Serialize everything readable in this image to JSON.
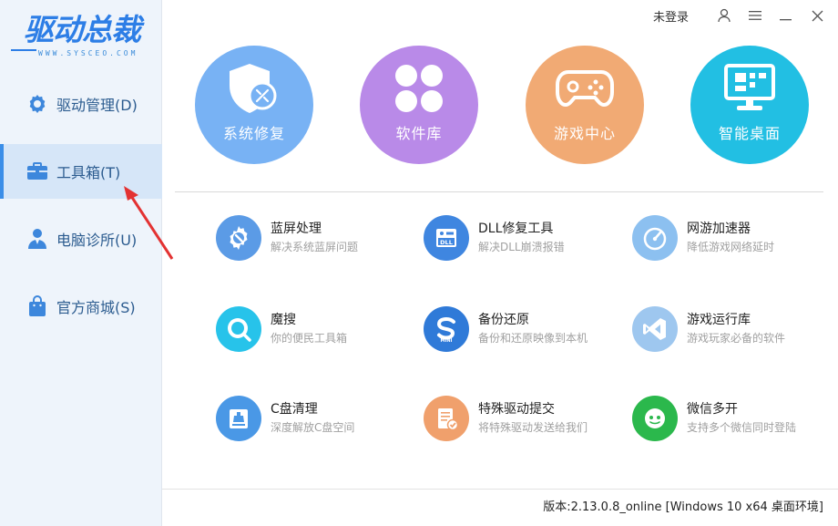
{
  "app": {
    "logo_text": "驱动总裁",
    "logo_sub": "WWW.SYSCEO.COM"
  },
  "sidebar": {
    "items": [
      {
        "label": "驱动管理(D)",
        "icon": "gear-icon",
        "active": false
      },
      {
        "label": "工具箱(T)",
        "icon": "toolbox-icon",
        "active": true
      },
      {
        "label": "电脑诊所(U)",
        "icon": "person-icon",
        "active": false
      },
      {
        "label": "官方商城(S)",
        "icon": "shopping-bag-icon",
        "active": false
      }
    ]
  },
  "topbar": {
    "login_label": "未登录"
  },
  "featured": [
    {
      "label": "系统修复",
      "icon": "shield-wrench-icon",
      "color": "#78b2f4"
    },
    {
      "label": "软件库",
      "icon": "four-petal-icon",
      "color": "#b98ae8"
    },
    {
      "label": "游戏中心",
      "icon": "gamepad-icon",
      "color": "#f1aa74"
    },
    {
      "label": "智能桌面",
      "icon": "monitor-icon",
      "color": "#22bfe3"
    }
  ],
  "tools": [
    {
      "title": "蓝屏处理",
      "desc": "解决系统蓝屏问题",
      "icon": "gear-wrench-icon",
      "color": "#5b9be6"
    },
    {
      "title": "DLL修复工具",
      "desc": "解决DLL崩溃报错",
      "icon": "dll-icon",
      "color": "#3f86e0"
    },
    {
      "title": "网游加速器",
      "desc": "降低游戏网络延时",
      "icon": "speedometer-icon",
      "color": "#8cc0f0"
    },
    {
      "title": "魔搜",
      "desc": "你的便民工具箱",
      "icon": "magnifier-icon",
      "color": "#27c3ea"
    },
    {
      "title": "备份还原",
      "desc": "备份和还原映像到本机",
      "icon": "backup-s-icon",
      "color": "#2f7ad8"
    },
    {
      "title": "游戏运行库",
      "desc": "游戏玩家必备的软件",
      "icon": "runtime-icon",
      "color": "#9ec7ef"
    },
    {
      "title": "C盘清理",
      "desc": "深度解放C盘空间",
      "icon": "disk-brush-icon",
      "color": "#4a98e6"
    },
    {
      "title": "特殊驱动提交",
      "desc": "将特殊驱动发送给我们",
      "icon": "document-check-icon",
      "color": "#f0a06c"
    },
    {
      "title": "微信多开",
      "desc": "支持多个微信同时登陆",
      "icon": "wechat-icon",
      "color": "#2bb84c"
    }
  ],
  "footer": {
    "version": "版本:2.13.0.8_online [Windows 10 x64 桌面环境]"
  }
}
